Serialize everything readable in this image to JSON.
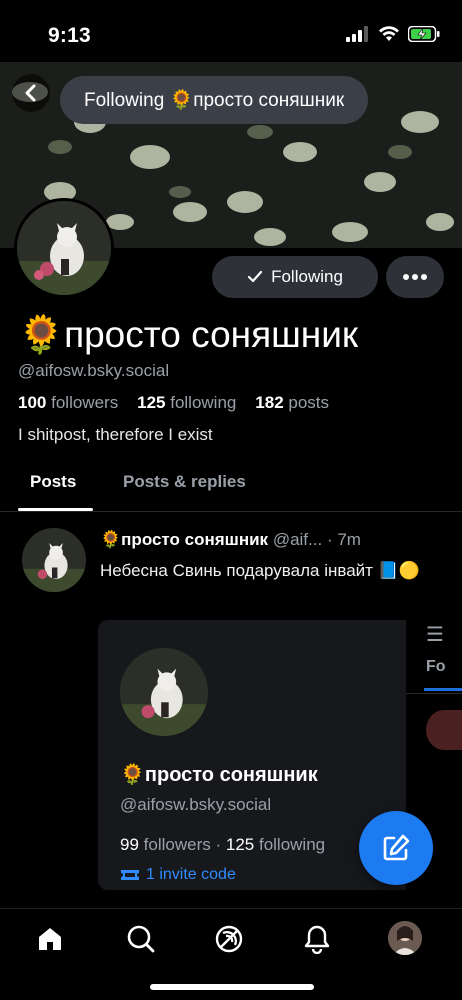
{
  "status_bar": {
    "time": "9:13"
  },
  "header": {
    "title": "Following 🌻просто соняшник"
  },
  "profile": {
    "display_name": "🌻просто соняшник",
    "handle": "@aifosw.bsky.social",
    "followers_count": "100",
    "followers_label": "followers",
    "following_count": "125",
    "following_label": "following",
    "posts_count": "182",
    "posts_label": "posts",
    "bio": "I shitpost, therefore I exist",
    "following_button": "Following"
  },
  "tabs": [
    {
      "label": "Posts",
      "active": true
    },
    {
      "label": "Posts & replies",
      "active": false
    }
  ],
  "post": {
    "author_name": "🌻просто соняшник",
    "author_handle": "@aif...",
    "time": "· 7m",
    "text": "Небесна Свинь подарувала інвайт 📘🟡"
  },
  "embed": {
    "name": "🌻просто соняшник",
    "handle": "@aifosw.bsky.social",
    "followers_count": "99",
    "followers_label": "followers ·",
    "following_count": "125",
    "following_label": "following",
    "invite": "1 invite code",
    "side_tab": "Fo"
  },
  "colors": {
    "accent": "#1d7bf2",
    "link": "#2f8cff",
    "muted": "#9aa0a8",
    "button_bg": "#2e3238"
  },
  "nav": {
    "items": [
      "home-icon",
      "search-icon",
      "feeds-icon",
      "notifications-icon",
      "profile-avatar"
    ]
  }
}
